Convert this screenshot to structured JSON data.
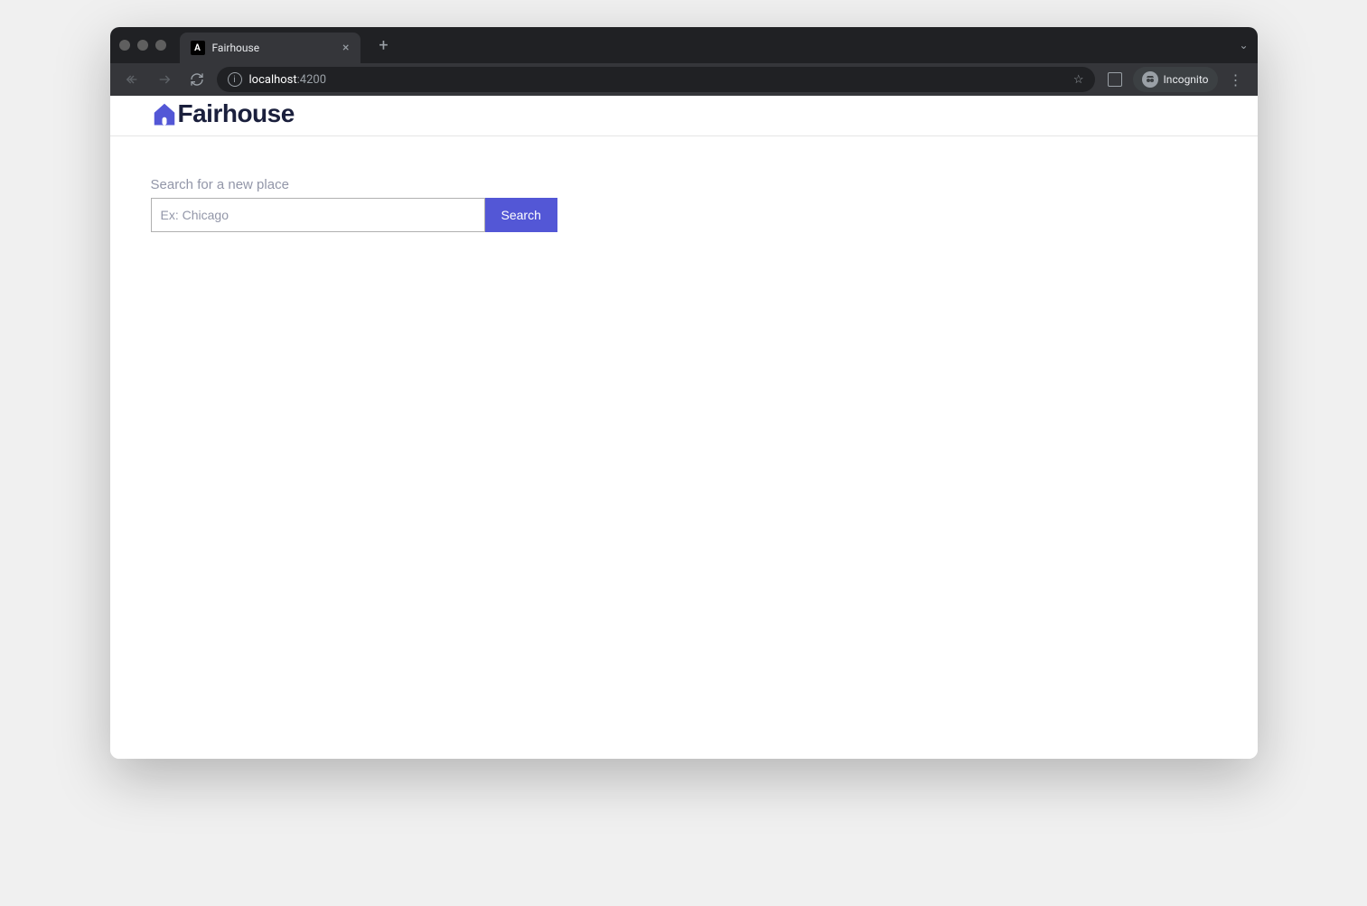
{
  "browser": {
    "tab": {
      "favicon_letter": "A",
      "title": "Fairhouse"
    },
    "url": {
      "host": "localhost",
      "port": ":4200"
    },
    "incognito_label": "Incognito"
  },
  "app": {
    "brand": "Fairhouse",
    "accent_color": "#5357d6"
  },
  "search": {
    "label": "Search for a new place",
    "placeholder": "Ex: Chicago",
    "value": "",
    "button_label": "Search"
  }
}
